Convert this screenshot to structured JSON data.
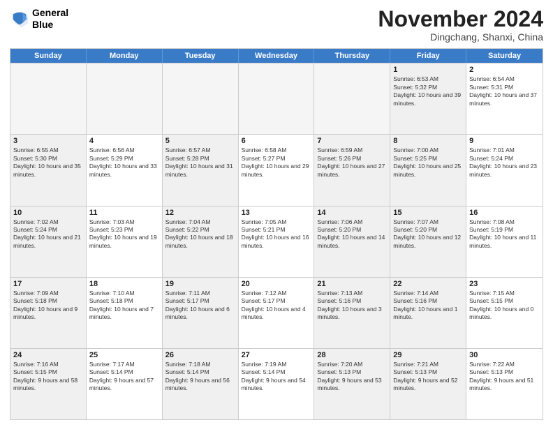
{
  "header": {
    "logo_line1": "General",
    "logo_line2": "Blue",
    "month_title": "November 2024",
    "subtitle": "Dingchang, Shanxi, China"
  },
  "weekdays": [
    "Sunday",
    "Monday",
    "Tuesday",
    "Wednesday",
    "Thursday",
    "Friday",
    "Saturday"
  ],
  "rows": [
    [
      {
        "day": "",
        "text": "",
        "empty": true
      },
      {
        "day": "",
        "text": "",
        "empty": true
      },
      {
        "day": "",
        "text": "",
        "empty": true
      },
      {
        "day": "",
        "text": "",
        "empty": true
      },
      {
        "day": "",
        "text": "",
        "empty": true
      },
      {
        "day": "1",
        "text": "Sunrise: 6:53 AM\nSunset: 5:32 PM\nDaylight: 10 hours and 39 minutes.",
        "shaded": true
      },
      {
        "day": "2",
        "text": "Sunrise: 6:54 AM\nSunset: 5:31 PM\nDaylight: 10 hours and 37 minutes.",
        "shaded": false
      }
    ],
    [
      {
        "day": "3",
        "text": "Sunrise: 6:55 AM\nSunset: 5:30 PM\nDaylight: 10 hours and 35 minutes.",
        "shaded": true
      },
      {
        "day": "4",
        "text": "Sunrise: 6:56 AM\nSunset: 5:29 PM\nDaylight: 10 hours and 33 minutes.",
        "shaded": false
      },
      {
        "day": "5",
        "text": "Sunrise: 6:57 AM\nSunset: 5:28 PM\nDaylight: 10 hours and 31 minutes.",
        "shaded": true
      },
      {
        "day": "6",
        "text": "Sunrise: 6:58 AM\nSunset: 5:27 PM\nDaylight: 10 hours and 29 minutes.",
        "shaded": false
      },
      {
        "day": "7",
        "text": "Sunrise: 6:59 AM\nSunset: 5:26 PM\nDaylight: 10 hours and 27 minutes.",
        "shaded": true
      },
      {
        "day": "8",
        "text": "Sunrise: 7:00 AM\nSunset: 5:25 PM\nDaylight: 10 hours and 25 minutes.",
        "shaded": true
      },
      {
        "day": "9",
        "text": "Sunrise: 7:01 AM\nSunset: 5:24 PM\nDaylight: 10 hours and 23 minutes.",
        "shaded": false
      }
    ],
    [
      {
        "day": "10",
        "text": "Sunrise: 7:02 AM\nSunset: 5:24 PM\nDaylight: 10 hours and 21 minutes.",
        "shaded": true
      },
      {
        "day": "11",
        "text": "Sunrise: 7:03 AM\nSunset: 5:23 PM\nDaylight: 10 hours and 19 minutes.",
        "shaded": false
      },
      {
        "day": "12",
        "text": "Sunrise: 7:04 AM\nSunset: 5:22 PM\nDaylight: 10 hours and 18 minutes.",
        "shaded": true
      },
      {
        "day": "13",
        "text": "Sunrise: 7:05 AM\nSunset: 5:21 PM\nDaylight: 10 hours and 16 minutes.",
        "shaded": false
      },
      {
        "day": "14",
        "text": "Sunrise: 7:06 AM\nSunset: 5:20 PM\nDaylight: 10 hours and 14 minutes.",
        "shaded": true
      },
      {
        "day": "15",
        "text": "Sunrise: 7:07 AM\nSunset: 5:20 PM\nDaylight: 10 hours and 12 minutes.",
        "shaded": true
      },
      {
        "day": "16",
        "text": "Sunrise: 7:08 AM\nSunset: 5:19 PM\nDaylight: 10 hours and 11 minutes.",
        "shaded": false
      }
    ],
    [
      {
        "day": "17",
        "text": "Sunrise: 7:09 AM\nSunset: 5:18 PM\nDaylight: 10 hours and 9 minutes.",
        "shaded": true
      },
      {
        "day": "18",
        "text": "Sunrise: 7:10 AM\nSunset: 5:18 PM\nDaylight: 10 hours and 7 minutes.",
        "shaded": false
      },
      {
        "day": "19",
        "text": "Sunrise: 7:11 AM\nSunset: 5:17 PM\nDaylight: 10 hours and 6 minutes.",
        "shaded": true
      },
      {
        "day": "20",
        "text": "Sunrise: 7:12 AM\nSunset: 5:17 PM\nDaylight: 10 hours and 4 minutes.",
        "shaded": false
      },
      {
        "day": "21",
        "text": "Sunrise: 7:13 AM\nSunset: 5:16 PM\nDaylight: 10 hours and 3 minutes.",
        "shaded": true
      },
      {
        "day": "22",
        "text": "Sunrise: 7:14 AM\nSunset: 5:16 PM\nDaylight: 10 hours and 1 minute.",
        "shaded": true
      },
      {
        "day": "23",
        "text": "Sunrise: 7:15 AM\nSunset: 5:15 PM\nDaylight: 10 hours and 0 minutes.",
        "shaded": false
      }
    ],
    [
      {
        "day": "24",
        "text": "Sunrise: 7:16 AM\nSunset: 5:15 PM\nDaylight: 9 hours and 58 minutes.",
        "shaded": true
      },
      {
        "day": "25",
        "text": "Sunrise: 7:17 AM\nSunset: 5:14 PM\nDaylight: 9 hours and 57 minutes.",
        "shaded": false
      },
      {
        "day": "26",
        "text": "Sunrise: 7:18 AM\nSunset: 5:14 PM\nDaylight: 9 hours and 56 minutes.",
        "shaded": true
      },
      {
        "day": "27",
        "text": "Sunrise: 7:19 AM\nSunset: 5:14 PM\nDaylight: 9 hours and 54 minutes.",
        "shaded": false
      },
      {
        "day": "28",
        "text": "Sunrise: 7:20 AM\nSunset: 5:13 PM\nDaylight: 9 hours and 53 minutes.",
        "shaded": true
      },
      {
        "day": "29",
        "text": "Sunrise: 7:21 AM\nSunset: 5:13 PM\nDaylight: 9 hours and 52 minutes.",
        "shaded": true
      },
      {
        "day": "30",
        "text": "Sunrise: 7:22 AM\nSunset: 5:13 PM\nDaylight: 9 hours and 51 minutes.",
        "shaded": false
      }
    ]
  ]
}
